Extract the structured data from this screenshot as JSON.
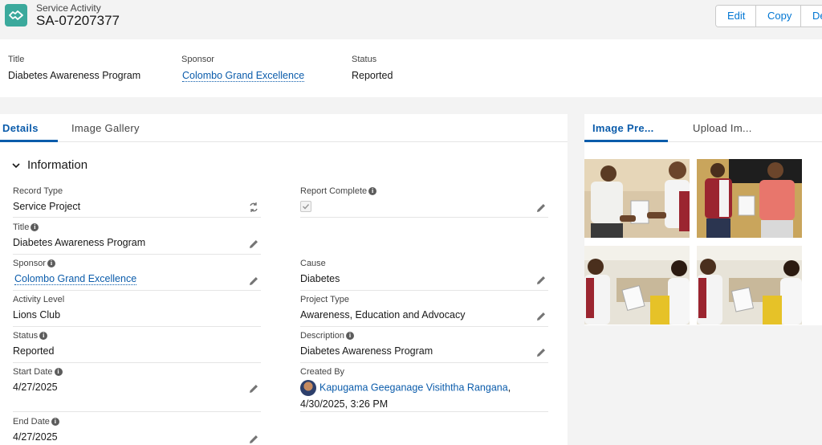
{
  "header": {
    "object_label": "Service Activity",
    "record_id": "SA-07207377",
    "buttons": [
      "Edit",
      "Copy",
      "De"
    ]
  },
  "highlights": {
    "title_label": "Title",
    "title_value": "Diabetes Awareness Program",
    "sponsor_label": "Sponsor",
    "sponsor_value": "Colombo Grand Excellence",
    "status_label": "Status",
    "status_value": "Reported"
  },
  "left_tabs": {
    "details": "Details",
    "gallery": "Image Gallery"
  },
  "section": {
    "title": "Information"
  },
  "fields": {
    "record_type": {
      "label": "Record Type",
      "value": "Service Project"
    },
    "report_complete": {
      "label": "Report Complete"
    },
    "title": {
      "label": "Title",
      "value": "Diabetes Awareness Program"
    },
    "sponsor": {
      "label": "Sponsor",
      "value": "Colombo Grand Excellence"
    },
    "cause": {
      "label": "Cause",
      "value": "Diabetes"
    },
    "activity_level": {
      "label": "Activity Level",
      "value": "Lions Club"
    },
    "project_type": {
      "label": "Project Type",
      "value": "Awareness, Education and Advocacy"
    },
    "status": {
      "label": "Status",
      "value": "Reported"
    },
    "description": {
      "label": "Description",
      "value": "Diabetes Awareness Program"
    },
    "start_date": {
      "label": "Start Date",
      "value": "4/27/2025"
    },
    "created_by": {
      "label": "Created By",
      "user": "Kapugama Geeganage Visiththa Rangana",
      "sep": ",",
      "date": "4/30/2025, 3:26 PM"
    },
    "end_date": {
      "label": "End Date",
      "value": "4/27/2025"
    }
  },
  "right_tabs": {
    "preview": "Image Pre...",
    "upload": "Upload Im..."
  },
  "colors": {
    "accent": "#0b5cab",
    "brand_icon": "#3ba99c"
  }
}
